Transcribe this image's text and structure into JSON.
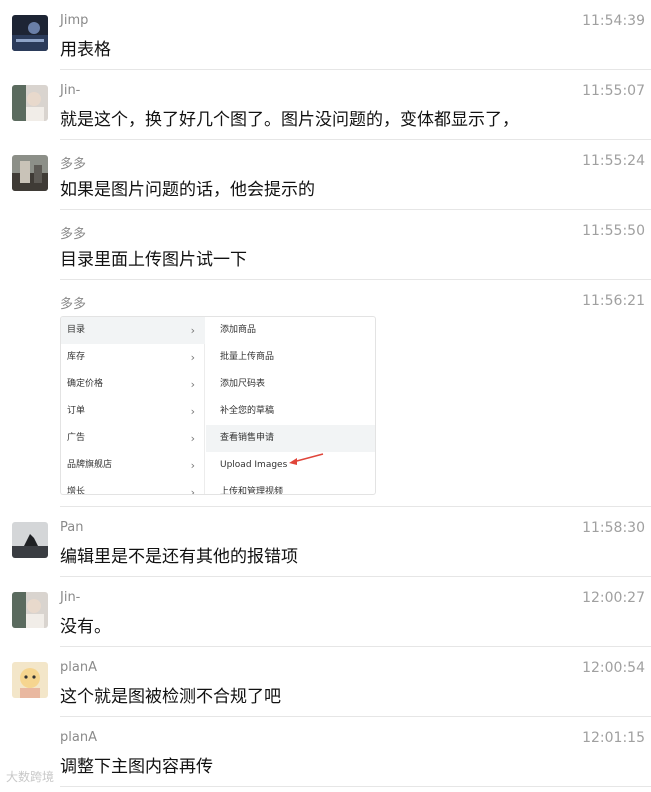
{
  "messages": [
    {
      "sender": "Jimp",
      "time": "11:54:39",
      "text": "用表格",
      "has_avatar": true
    },
    {
      "sender": "Jin-",
      "time": "11:55:07",
      "text": "就是这个，换了好几个图了。图片没问题的，变体都显示了，",
      "has_avatar": true
    },
    {
      "sender": "多多",
      "time": "11:55:24",
      "text": "如果是图片问题的话，他会提示的",
      "has_avatar": true
    },
    {
      "sender": "多多",
      "time": "11:55:50",
      "text": "目录里面上传图片试一下",
      "has_avatar": false
    },
    {
      "sender": "多多",
      "time": "11:56:21",
      "text": "",
      "has_avatar": false,
      "has_image": true
    },
    {
      "sender": "Pan",
      "time": "11:58:30",
      "text": "编辑里是不是还有其他的报错项",
      "has_avatar": true
    },
    {
      "sender": "Jin-",
      "time": "12:00:27",
      "text": "没有。",
      "has_avatar": true
    },
    {
      "sender": "planA",
      "time": "12:00:54",
      "text": "这个就是图被检测不合规了吧",
      "has_avatar": true
    },
    {
      "sender": "planA",
      "time": "12:01:15",
      "text": "调整下主图内容再传",
      "has_avatar": false
    }
  ],
  "screenshot": {
    "menu_items": [
      "目录",
      "库存",
      "确定价格",
      "订单",
      "广告",
      "品牌旗舰店",
      "增长"
    ],
    "chevron": "›",
    "submenu_items": [
      "添加商品",
      "批量上传商品",
      "添加尺码表",
      "补全您的草稿",
      "查看销售申请",
      "Upload Images",
      "上传和管理视频"
    ]
  },
  "watermark": "大数跨境",
  "colors": {
    "arrow": "#e0453a",
    "divider": "#e6e6e6"
  }
}
